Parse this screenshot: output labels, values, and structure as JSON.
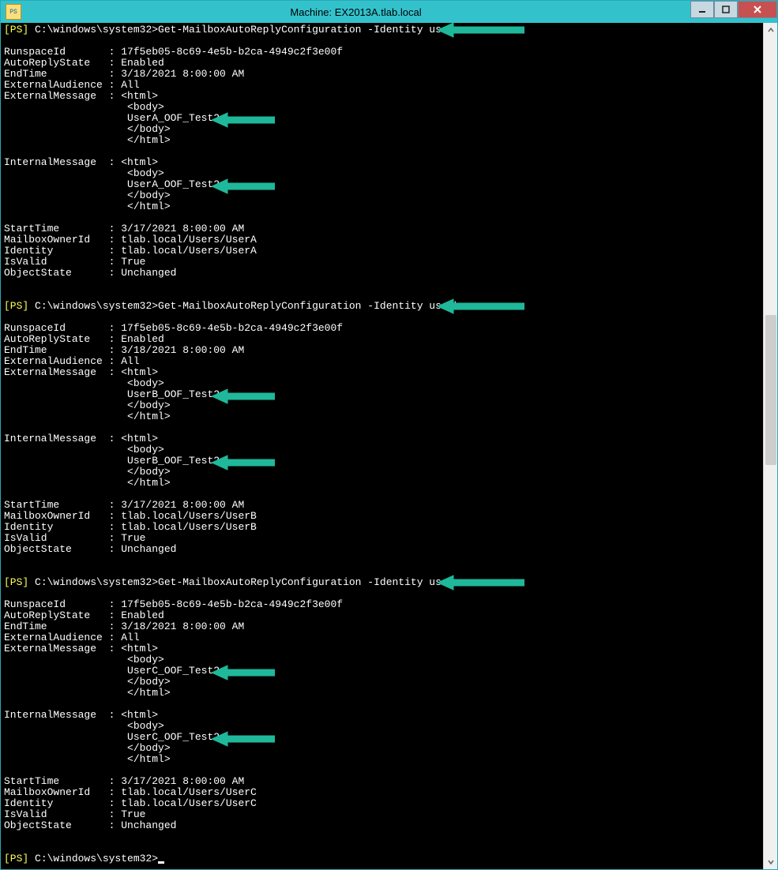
{
  "window": {
    "title": "Machine: EX2013A.tlab.local"
  },
  "prompt": {
    "bracket_open": "[PS]",
    "path": "C:\\windows\\system32>",
    "cmd_base": "Get-MailboxAutoReplyConfiguration -Identity "
  },
  "sessions": [
    {
      "user_arg": "usera",
      "fields": {
        "RunspaceId": "17f5eb05-8c69-4e5b-b2ca-4949c2f3e00f",
        "AutoReplyState": "Enabled",
        "EndTime": "3/18/2021 8:00:00 AM",
        "ExternalAudience": "All",
        "ExternalMessage": {
          "lines": [
            "<html>",
            "<body>",
            "UserA_OOF_Test2",
            "</body>",
            "</html>"
          ]
        },
        "InternalMessage": {
          "lines": [
            "<html>",
            "<body>",
            "UserA_OOF_Test2",
            "</body>",
            "</html>"
          ]
        },
        "StartTime": "3/17/2021 8:00:00 AM",
        "MailboxOwnerId": "tlab.local/Users/UserA",
        "Identity": "tlab.local/Users/UserA",
        "IsValid": "True",
        "ObjectState": "Unchanged"
      }
    },
    {
      "user_arg": "userb",
      "fields": {
        "RunspaceId": "17f5eb05-8c69-4e5b-b2ca-4949c2f3e00f",
        "AutoReplyState": "Enabled",
        "EndTime": "3/18/2021 8:00:00 AM",
        "ExternalAudience": "All",
        "ExternalMessage": {
          "lines": [
            "<html>",
            "<body>",
            "UserB_OOF_Test2",
            "</body>",
            "</html>"
          ]
        },
        "InternalMessage": {
          "lines": [
            "<html>",
            "<body>",
            "UserB_OOF_Test2",
            "</body>",
            "</html>"
          ]
        },
        "StartTime": "3/17/2021 8:00:00 AM",
        "MailboxOwnerId": "tlab.local/Users/UserB",
        "Identity": "tlab.local/Users/UserB",
        "IsValid": "True",
        "ObjectState": "Unchanged"
      }
    },
    {
      "user_arg": "userc",
      "fields": {
        "RunspaceId": "17f5eb05-8c69-4e5b-b2ca-4949c2f3e00f",
        "AutoReplyState": "Enabled",
        "EndTime": "3/18/2021 8:00:00 AM",
        "ExternalAudience": "All",
        "ExternalMessage": {
          "lines": [
            "<html>",
            "<body>",
            "UserC_OOF_Test2",
            "</body>",
            "</html>"
          ]
        },
        "InternalMessage": {
          "lines": [
            "<html>",
            "<body>",
            "UserC_OOF_Test2",
            "</body>",
            "</html>"
          ]
        },
        "StartTime": "3/17/2021 8:00:00 AM",
        "MailboxOwnerId": "tlab.local/Users/UserC",
        "Identity": "tlab.local/Users/UserC",
        "IsValid": "True",
        "ObjectState": "Unchanged"
      }
    }
  ],
  "labels": {
    "RunspaceId": "RunspaceId",
    "AutoReplyState": "AutoReplyState",
    "EndTime": "EndTime",
    "ExternalAudience": "ExternalAudience",
    "ExternalMessage": "ExternalMessage",
    "InternalMessage": "InternalMessage",
    "StartTime": "StartTime",
    "MailboxOwnerId": "MailboxOwnerId",
    "Identity": "Identity",
    "IsValid": "IsValid",
    "ObjectState": "ObjectState"
  },
  "arrow_color": "#1fb89a"
}
